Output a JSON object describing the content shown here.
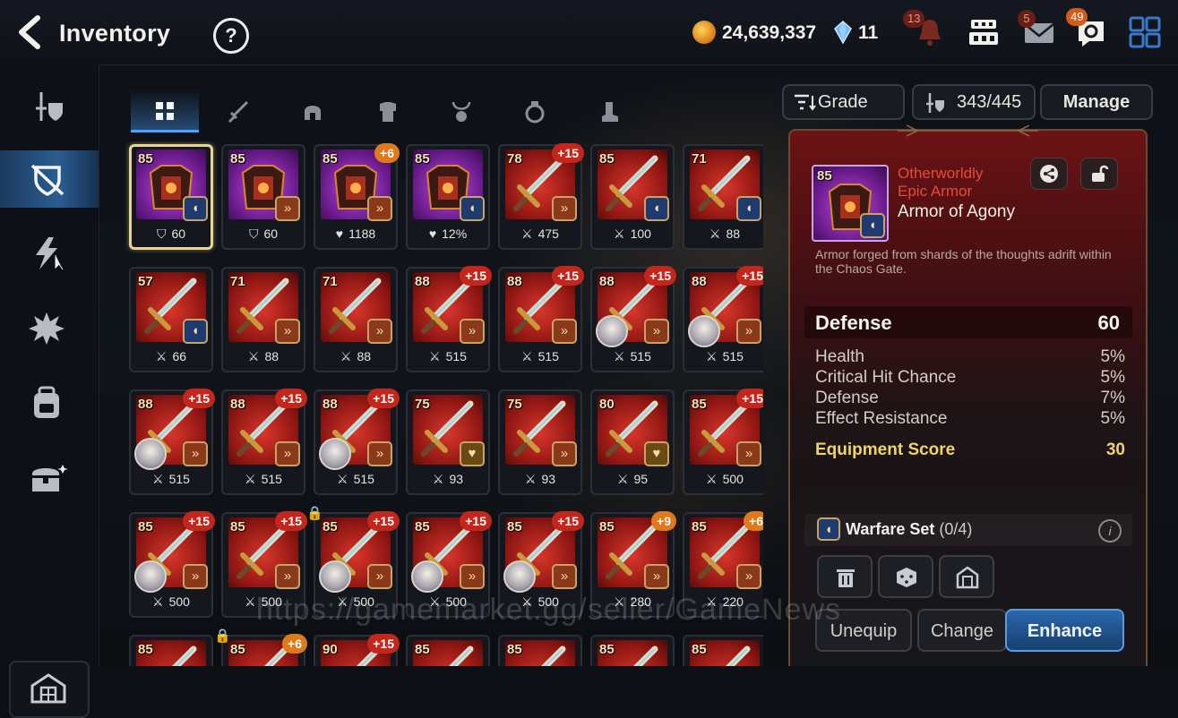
{
  "header": {
    "title": "Inventory",
    "help_symbol": "?",
    "gold": "24,639,337",
    "crystals": "11",
    "notification_count": "13",
    "mail_count": "5",
    "chat_count": "49"
  },
  "tabs": [
    "all-icon",
    "weapon-icon",
    "helmet-icon",
    "armor-icon",
    "necklace-icon",
    "ring-icon",
    "boots-icon"
  ],
  "toolbar": {
    "grade_label": "Grade",
    "capacity": "343/445",
    "manage_label": "Manage"
  },
  "grid_items": [
    {
      "lvl": "85",
      "plus": "",
      "rarity": "epic",
      "set": "shield",
      "stat_icon": "defense",
      "stat": "60",
      "selected": true
    },
    {
      "lvl": "85",
      "plus": "",
      "rarity": "epic",
      "set": "copper",
      "stat_icon": "defense",
      "stat": "60"
    },
    {
      "lvl": "85",
      "plus": "+6",
      "plus_color": "orange",
      "rarity": "epic",
      "set": "copper",
      "stat_icon": "health",
      "stat": "1188"
    },
    {
      "lvl": "85",
      "plus": "",
      "rarity": "epic",
      "set": "shield",
      "stat_icon": "health",
      "stat": "12%"
    },
    {
      "lvl": "78",
      "plus": "+15",
      "rarity": "heroic",
      "set": "copper",
      "stat_icon": "attack",
      "stat": "475"
    },
    {
      "lvl": "85",
      "plus": "",
      "rarity": "heroic",
      "set": "shield",
      "stat_icon": "attack",
      "stat": "100"
    },
    {
      "lvl": "71",
      "plus": "",
      "rarity": "heroic",
      "set": "shield",
      "stat_icon": "attack",
      "stat": "88"
    },
    {
      "lvl": "57",
      "plus": "",
      "rarity": "heroic",
      "set": "shield",
      "stat_icon": "attack",
      "stat": "66"
    },
    {
      "lvl": "71",
      "plus": "",
      "rarity": "heroic",
      "set": "copper",
      "stat_icon": "attack",
      "stat": "88"
    },
    {
      "lvl": "71",
      "plus": "",
      "rarity": "heroic",
      "set": "copper",
      "stat_icon": "attack",
      "stat": "88"
    },
    {
      "lvl": "88",
      "plus": "+15",
      "rarity": "heroic",
      "set": "copper",
      "stat_icon": "attack",
      "stat": "515"
    },
    {
      "lvl": "88",
      "plus": "+15",
      "rarity": "heroic",
      "set": "copper",
      "stat_icon": "attack",
      "stat": "515"
    },
    {
      "lvl": "88",
      "plus": "+15",
      "rarity": "heroic",
      "set": "copper",
      "stat_icon": "attack",
      "stat": "515",
      "hero": true
    },
    {
      "lvl": "88",
      "plus": "+15",
      "rarity": "heroic",
      "set": "copper",
      "stat_icon": "attack",
      "stat": "515",
      "hero": true
    },
    {
      "lvl": "88",
      "plus": "+15",
      "rarity": "heroic",
      "set": "copper",
      "stat_icon": "attack",
      "stat": "515",
      "hero": true
    },
    {
      "lvl": "88",
      "plus": "+15",
      "rarity": "heroic",
      "set": "copper",
      "stat_icon": "attack",
      "stat": "515"
    },
    {
      "lvl": "88",
      "plus": "+15",
      "rarity": "heroic",
      "set": "copper",
      "stat_icon": "attack",
      "stat": "515",
      "hero": true
    },
    {
      "lvl": "75",
      "plus": "",
      "rarity": "heroic",
      "set": "gold",
      "stat_icon": "attack",
      "stat": "93"
    },
    {
      "lvl": "75",
      "plus": "",
      "rarity": "heroic",
      "set": "copper",
      "stat_icon": "attack",
      "stat": "93"
    },
    {
      "lvl": "80",
      "plus": "",
      "rarity": "heroic",
      "set": "gold",
      "stat_icon": "attack",
      "stat": "95"
    },
    {
      "lvl": "85",
      "plus": "+15",
      "rarity": "heroic",
      "set": "copper",
      "stat_icon": "attack",
      "stat": "500"
    },
    {
      "lvl": "85",
      "plus": "+15",
      "rarity": "heroic",
      "set": "copper",
      "stat_icon": "attack",
      "stat": "500",
      "hero": true
    },
    {
      "lvl": "85",
      "plus": "+15",
      "rarity": "heroic",
      "set": "copper",
      "stat_icon": "attack",
      "stat": "500"
    },
    {
      "lvl": "85",
      "plus": "+15",
      "rarity": "heroic",
      "set": "copper",
      "stat_icon": "attack",
      "stat": "500",
      "hero": true,
      "locked": true
    },
    {
      "lvl": "85",
      "plus": "+15",
      "rarity": "heroic",
      "set": "copper",
      "stat_icon": "attack",
      "stat": "500",
      "hero": true
    },
    {
      "lvl": "85",
      "plus": "+15",
      "rarity": "heroic",
      "set": "copper",
      "stat_icon": "attack",
      "stat": "500",
      "hero": true
    },
    {
      "lvl": "85",
      "plus": "+9",
      "plus_color": "orange",
      "rarity": "heroic",
      "set": "copper",
      "stat_icon": "attack",
      "stat": "280"
    },
    {
      "lvl": "85",
      "plus": "+6",
      "plus_color": "orange",
      "rarity": "heroic",
      "set": "copper",
      "stat_icon": "attack",
      "stat": "220"
    },
    {
      "lvl": "85",
      "plus": "",
      "rarity": "heroic",
      "set": "copper",
      "stat_icon": "attack",
      "stat": ""
    },
    {
      "lvl": "85",
      "plus": "+6",
      "plus_color": "orange",
      "rarity": "heroic",
      "set": "copper",
      "stat_icon": "attack",
      "stat": "",
      "locked": true
    },
    {
      "lvl": "90",
      "plus": "+15",
      "rarity": "heroic",
      "set": "copper",
      "stat_icon": "attack",
      "stat": ""
    },
    {
      "lvl": "85",
      "plus": "",
      "rarity": "heroic",
      "set": "copper",
      "stat_icon": "attack",
      "stat": ""
    },
    {
      "lvl": "85",
      "plus": "",
      "rarity": "heroic",
      "set": "copper",
      "stat_icon": "attack",
      "stat": ""
    },
    {
      "lvl": "85",
      "plus": "",
      "rarity": "heroic",
      "set": "copper",
      "stat_icon": "attack",
      "stat": ""
    },
    {
      "lvl": "85",
      "plus": "",
      "rarity": "heroic",
      "set": "copper",
      "stat_icon": "attack",
      "stat": ""
    }
  ],
  "detail": {
    "level": "85",
    "grade_line1": "Otherworldly",
    "grade_line2": "Epic Armor",
    "name": "Armor of Agony",
    "description": "Armor forged from shards of the thoughts adrift within the Chaos Gate.",
    "main_stat_label": "Defense",
    "main_stat_value": "60",
    "substats": [
      {
        "label": "Health",
        "value": "5%"
      },
      {
        "label": "Critical Hit Chance",
        "value": "5%"
      },
      {
        "label": "Defense",
        "value": "7%"
      },
      {
        "label": "Effect Resistance",
        "value": "5%"
      }
    ],
    "score_label": "Equipment Score",
    "score_value": "30",
    "set_name": "Warfare Set",
    "set_count": "(0/4)",
    "info_symbol": "i",
    "unequip_label": "Unequip",
    "change_label": "Change",
    "enhance_label": "Enhance"
  },
  "watermark": "https://gamemarket.gg/seller/GameNews",
  "colors": {
    "accent_blue": "#2a5d92",
    "epic_purple": "#8a2fb0",
    "heroic_red": "#a41c16",
    "score_gold": "#f0d46a",
    "enhance_blue": "#1e4f8e"
  }
}
